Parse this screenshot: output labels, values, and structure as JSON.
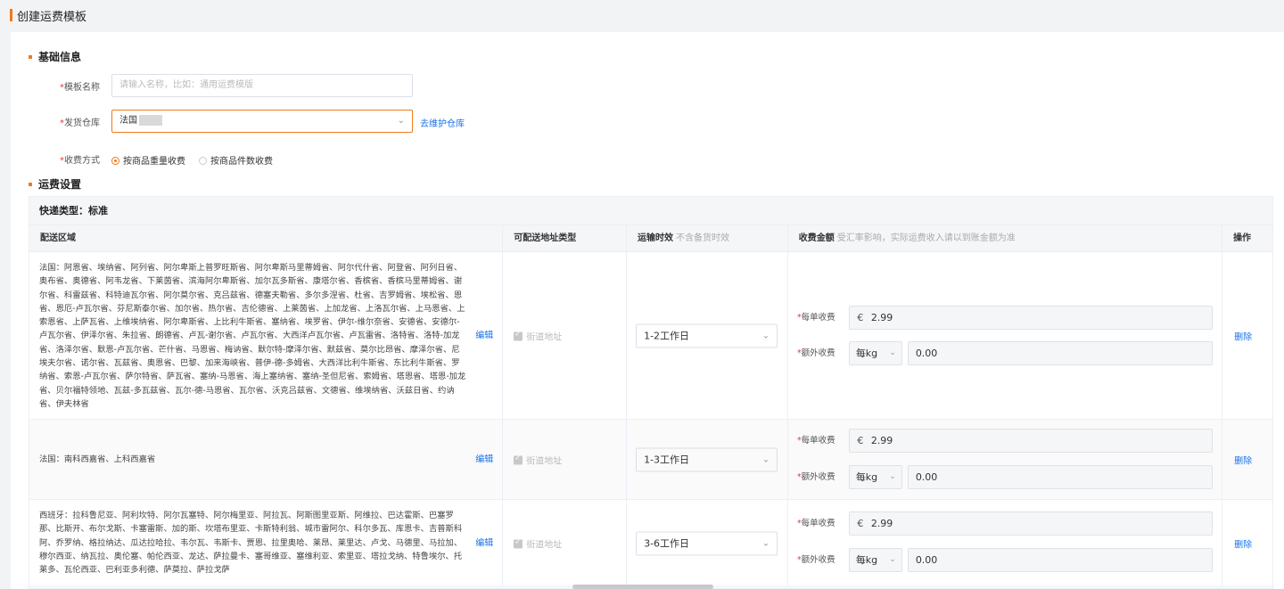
{
  "page": {
    "title": "创建运费模板",
    "accent_color": "#f27a1a",
    "link_color": "#1a73e8"
  },
  "basic": {
    "section_title": "基础信息",
    "name_label": "模板名称",
    "name_placeholder": "请输入名称，比如：通用运费模版",
    "warehouse_label": "发货仓库",
    "warehouse_value": "法国",
    "warehouse_link": "去维护仓库",
    "charge_label": "收费方式",
    "charge_options": [
      "按商品重量收费",
      "按商品件数收费"
    ],
    "charge_selected": 0
  },
  "shipping": {
    "section_title": "运费设置",
    "courier_type": "快递类型：标准",
    "columns": {
      "area": "配送区域",
      "addr_type": "可配送地址类型",
      "time": "运输时效",
      "time_sub": "不含备货时效",
      "fee": "收费金额",
      "fee_sub": "受汇率影响，实际运费收入请以到账金额为准",
      "op": "操作"
    },
    "rows": [
      {
        "area": "法国：阿恩省、埃纳省、阿列省、阿尔卑斯上普罗旺斯省、阿尔卑斯马里蒂姆省、阿尔代什省、阿登省、阿列日省、奥布省、奥德省、阿韦龙省、下莱茵省、滨海阿尔卑斯省、加尔瓦多斯省、康塔尔省、香槟省、香槟马里蒂姆省、谢尔省、科雷兹省、科特迪瓦尔省、阿尔莫尔省、克吕兹省、德塞夫勒省、多尔多涅省、杜省、吉罗姆省、埃松省、恩省、恩厄-卢瓦尔省、芬尼斯泰尔省、加尔省、热尔省、吉伦德省、上莱茵省、上加龙省、上洛瓦尔省、上马恩省、上索恩省、上萨瓦省、上维埃纳省、阿尔卑斯省、上比利牛斯省、塞纳省、埃罗省、伊尔-维尔奈省、安德省、安德尔-卢瓦尔省、伊泽尔省、朱拉省、朗德省、卢瓦-谢尔省、卢瓦尔省、大西洋卢瓦尔省、卢瓦雷省、洛特省、洛特-加龙省、洛泽尔省、默恩-卢瓦尔省、芒什省、马恩省、梅讷省、默尔特-摩泽尔省、默兹省、莫尔比昂省、摩泽尔省、尼埃夫尔省、诺尔省、瓦兹省、奥恩省、巴黎、加来海峡省、普伊-德-多姆省、大西洋比利牛斯省、东比利牛斯省、罗纳省、索恩-卢瓦尔省、萨尔特省、萨瓦省、塞纳-马恩省、海上塞纳省、塞纳-圣但尼省、索姆省、塔恩省、塔恩-加龙省、贝尔福特领地、瓦兹-多瓦兹省、瓦尔-德-马恩省、瓦尔省、沃克吕兹省、文德省、维埃纳省、沃兹日省、约讷省、伊夫林省",
        "edit": "编辑",
        "addr": "街道地址",
        "time": "1-2工作日",
        "per_order_label": "每单收费",
        "currency": "€",
        "per_order": "2.99",
        "extra_label": "额外收费",
        "unit": "每kg",
        "extra": "0.00",
        "delete": "删除"
      },
      {
        "area": "法国：南科西嘉省、上科西嘉省",
        "edit": "编辑",
        "addr": "街道地址",
        "time": "1-3工作日",
        "per_order_label": "每单收费",
        "currency": "€",
        "per_order": "2.99",
        "extra_label": "额外收费",
        "unit": "每kg",
        "extra": "0.00",
        "delete": "删除"
      },
      {
        "area": "西班牙：拉科鲁尼亚、阿利坎特、阿尔瓦塞特、阿尔梅里亚、阿拉瓦、阿斯图里亚斯、阿维拉、巴达霍斯、巴塞罗那、比斯开、布尔戈斯、卡塞雷斯、加的斯、坎塔布里亚、卡斯特利翁、城市雷阿尔、科尔多瓦、库恩卡、吉普斯科阿、乔罗纳、格拉纳达、瓜达拉哈拉、韦尔瓦、韦斯卡、贾恩、拉里奥哈、莱昂、莱里达、卢戈、马德里、马拉加、穆尔西亚、纳瓦拉、奥伦塞、帕伦西亚、龙达、萨拉曼卡、塞哥维亚、塞维利亚、索里亚、塔拉戈纳、特鲁埃尔、托莱多、瓦伦西亚、巴利亚多利德、萨莫拉、萨拉戈萨",
        "edit": "编辑",
        "addr": "街道地址",
        "time": "3-6工作日",
        "per_order_label": "每单收费",
        "currency": "€",
        "per_order": "2.99",
        "extra_label": "额外收费",
        "unit": "每kg",
        "extra": "0.00",
        "delete": "删除"
      }
    ]
  }
}
